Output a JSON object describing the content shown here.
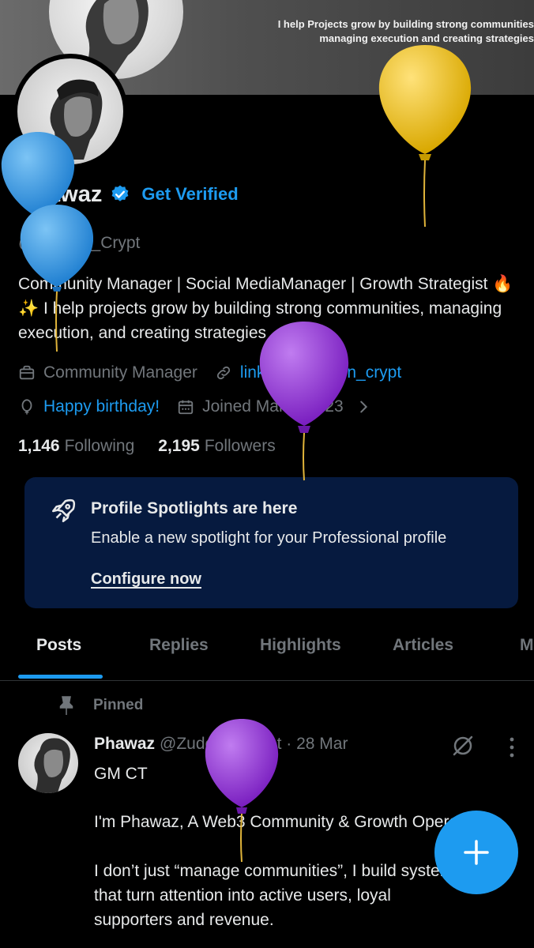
{
  "banner": {
    "text": "I help Projects grow by building strong communities managing execution and creating strategies"
  },
  "profile": {
    "display_name": "Phawaz",
    "get_verified": "Get Verified",
    "handle": "@Zudeen_Crypt",
    "bio": "Community Manager | Social MediaManager | Growth Strategist 🔥✨ I help projects grow by building strong communities, managing execution, and creating strategies",
    "category": "Community Manager",
    "link": "linktr.ee/zudeen_crypt",
    "birthday": "Happy birthday!",
    "joined": "Joined March 2023",
    "following_count": "1,146",
    "following_label": "Following",
    "followers_count": "2,195",
    "followers_label": "Followers"
  },
  "spotlight": {
    "title": "Profile Spotlights are here",
    "subtitle": "Enable a new spotlight for your Professional profile",
    "cta": "Configure now"
  },
  "tabs": [
    {
      "label": "Posts"
    },
    {
      "label": "Replies"
    },
    {
      "label": "Highlights"
    },
    {
      "label": "Articles"
    },
    {
      "label": "M"
    }
  ],
  "post": {
    "pinned_label": "Pinned",
    "author": "Phawaz",
    "meta": "@Zudeen_Crypt · 28 Mar",
    "lines": [
      "GM CT",
      "I'm Phawaz, A Web3 Community & Growth Operator.",
      "I don’t just “manage communities”, I build systems",
      "that turn attention into active users, loyal",
      "supporters and revenue."
    ]
  },
  "icons": {
    "verified": "verified-badge-icon",
    "briefcase": "briefcase-icon",
    "link": "link-icon",
    "balloon": "balloon-icon",
    "calendar": "calendar-icon",
    "chevron": "chevron-right-icon",
    "rocket": "rocket-icon",
    "pin": "pin-icon",
    "grok": "grok-icon",
    "more": "more-vertical-icon",
    "compose": "plus-icon"
  },
  "colors": {
    "accent": "#1d9bf0",
    "background": "#000000",
    "card": "#061a3f",
    "muted": "#71767b",
    "text": "#e7e9ea"
  }
}
